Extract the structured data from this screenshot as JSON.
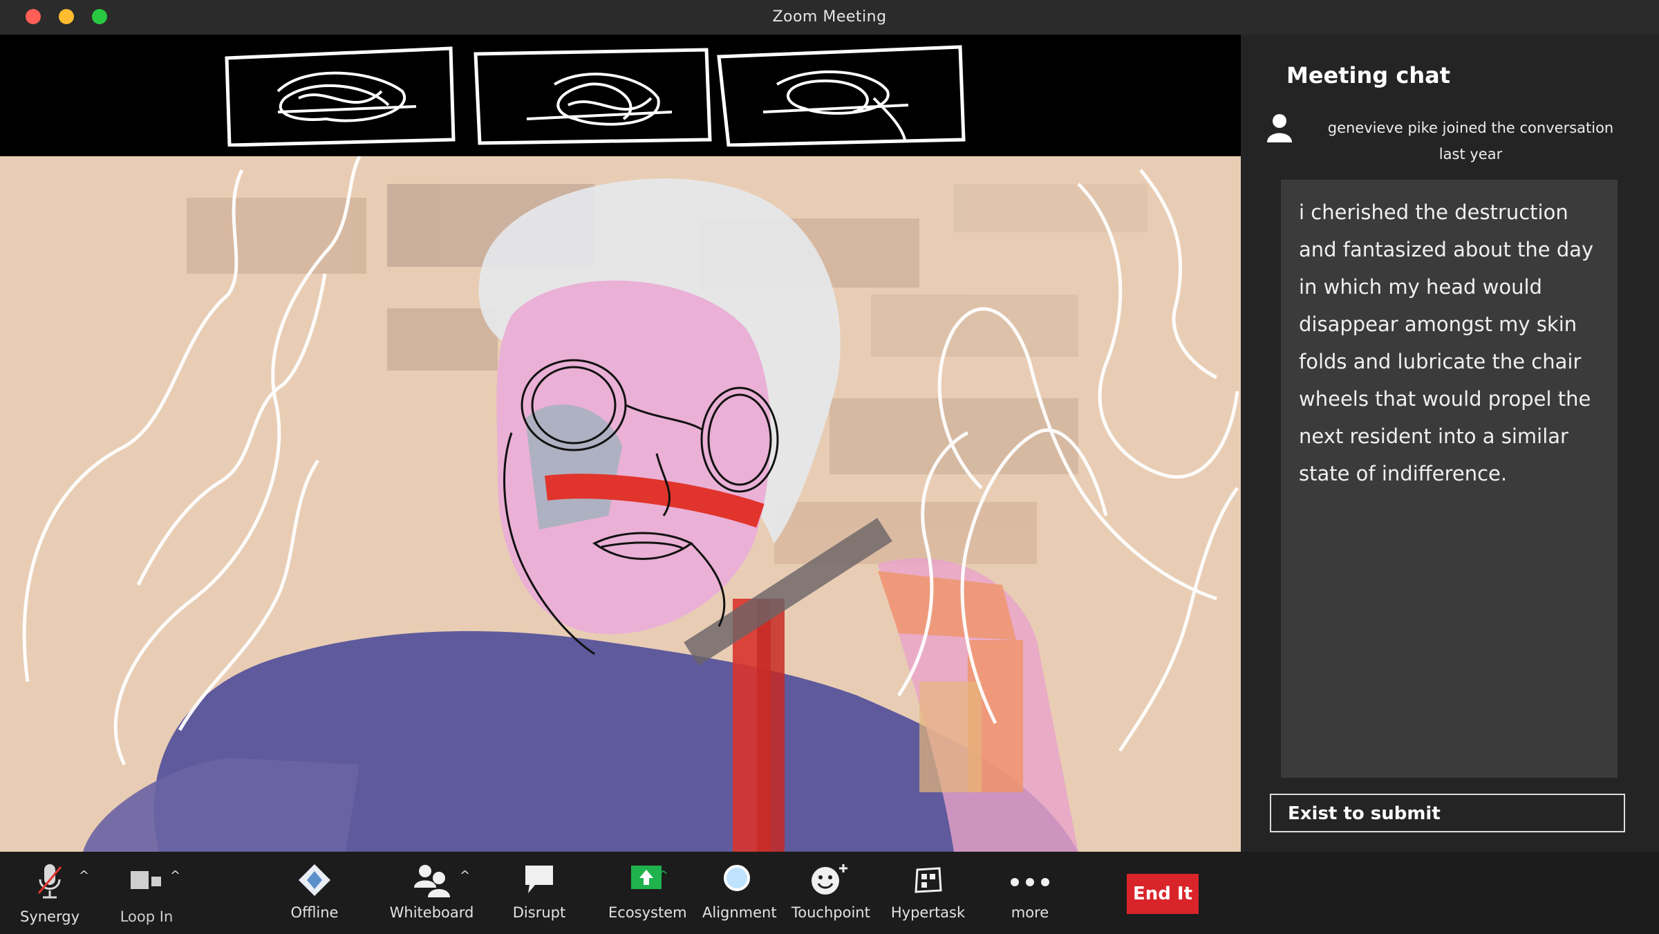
{
  "window": {
    "title": "Zoom Meeting"
  },
  "chat": {
    "title": "Meeting chat",
    "join_line": "genevieve pike  joined the conversation",
    "join_time": "last year",
    "message": "i cherished the destruction and fantasized about the day in which my head would disappear amongst my skin folds and lubricate the chair wheels that would propel the next resident into a similar state of indifference.",
    "input_placeholder": "Exist to submit"
  },
  "toolbar": {
    "items": [
      {
        "label": "Synergy",
        "icon": "microphone-muted-icon"
      },
      {
        "label": "Loop In",
        "icon": "video-camera-icon"
      },
      {
        "label": "Offline",
        "icon": "diamond-icon"
      },
      {
        "label": "Whiteboard",
        "icon": "participants-icon"
      },
      {
        "label": "Disrupt",
        "icon": "speech-bubble-icon"
      },
      {
        "label": "Ecosystem",
        "icon": "share-screen-icon"
      },
      {
        "label": "Alignment",
        "icon": "circle-icon"
      },
      {
        "label": "Touchpoint",
        "icon": "smiley-plus-icon"
      },
      {
        "label": "Hypertask",
        "icon": "apps-icon"
      },
      {
        "label": "more",
        "icon": "more-dots-icon"
      }
    ],
    "end_label": "End It"
  },
  "colors": {
    "end_button": "#d9242a",
    "share_green": "#1fb24d",
    "chat_message_bg": "#3b3b3b",
    "sidebar_bg": "#242424",
    "toolbar_bg": "#1c1c1c",
    "painting_bg": "#e8cdb4",
    "painting_purple": "#5f5a9c",
    "painting_red": "#e0342c",
    "painting_pink": "#e7a6d4"
  }
}
